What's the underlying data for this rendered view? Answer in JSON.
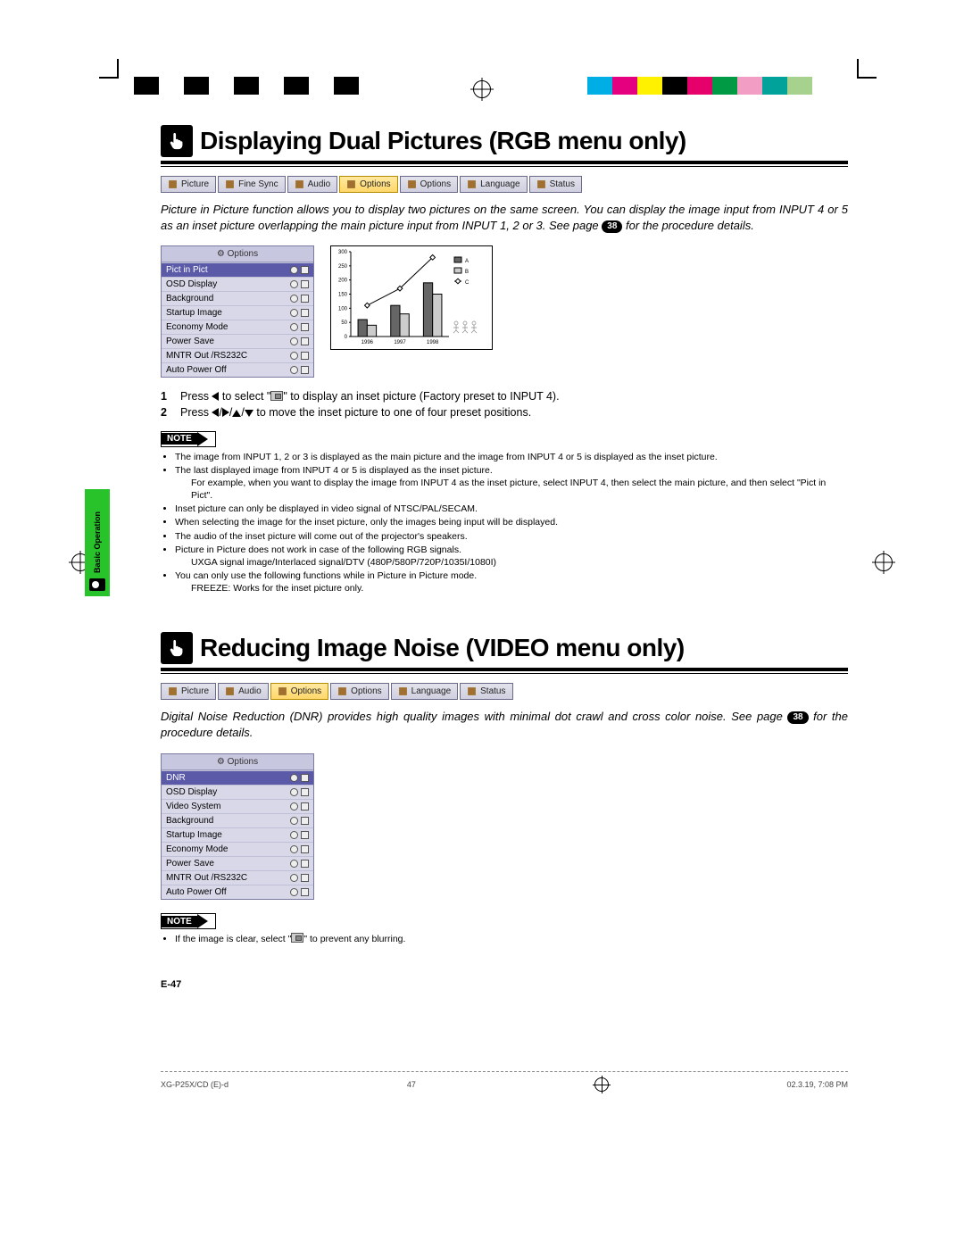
{
  "side_tab": "Basic Operation",
  "page_number": "E-47",
  "footer": {
    "left": "XG-P25X/CD (E)-d",
    "center": "47",
    "right": "02.3.19, 7:08 PM"
  },
  "color_bar_left": [
    "#000",
    "#fff",
    "#000",
    "#fff",
    "#000",
    "#fff",
    "#000",
    "#fff",
    "#000"
  ],
  "color_bar_right": [
    "#00aee6",
    "#e4007f",
    "#fff100",
    "#000",
    "#e5006b",
    "#009944",
    "#f29ec4",
    "#00a29a",
    "#a7d28d"
  ],
  "section1": {
    "title": "Displaying Dual Pictures (RGB menu only)",
    "tabs": [
      {
        "label": "Picture",
        "icon": "picture-icon"
      },
      {
        "label": "Fine Sync",
        "icon": "sync-icon"
      },
      {
        "label": "Audio",
        "icon": "audio-icon"
      },
      {
        "label": "Options",
        "icon": "options-icon",
        "active": true
      },
      {
        "label": "Options",
        "icon": "options-icon"
      },
      {
        "label": "Language",
        "icon": "language-icon"
      },
      {
        "label": "Status",
        "icon": "status-icon"
      }
    ],
    "intro_a": "Picture in Picture function allows you to display two pictures on the same screen. You can display the image input from INPUT 4 or 5 as an inset picture overlapping the main picture input from INPUT 1, 2 or 3. See page ",
    "intro_ref": "38",
    "intro_b": " for the procedure details.",
    "osd": {
      "header": "Options",
      "rows": [
        {
          "label": "Pict in Pict",
          "selected": true
        },
        {
          "label": "OSD Display"
        },
        {
          "label": "Background"
        },
        {
          "label": "Startup Image"
        },
        {
          "label": "Economy Mode"
        },
        {
          "label": "Power Save"
        },
        {
          "label": "MNTR Out /RS232C"
        },
        {
          "label": "Auto Power Off"
        }
      ]
    },
    "steps": [
      {
        "n": "1",
        "a": "Press ",
        "b": " to select \"",
        "c": "\" to display an inset picture (Factory preset to INPUT 4)."
      },
      {
        "n": "2",
        "a": "Press ",
        "b": " to move the inset picture to one of four preset positions."
      }
    ],
    "note_label": "NOTE",
    "notes": [
      "The image from INPUT 1, 2 or 3 is displayed as the main picture and the image from INPUT 4 or 5 is displayed as the inset picture.",
      "The last displayed image from INPUT 4 or 5 is displayed as the inset picture.",
      "__sub:For example, when you want to display the image from INPUT 4 as the inset picture, select INPUT 4, then select the main picture, and then select \"Pict in Pict\".",
      "Inset picture can only be displayed in video signal of NTSC/PAL/SECAM.",
      "When selecting the image for the inset picture, only the images being input will be displayed.",
      "The audio of the inset picture will come out of the projector's speakers.",
      "Picture in Picture does not work in case of the following RGB signals.",
      "__sub:UXGA signal image/Interlaced signal/DTV (480P/580P/720P/1035I/1080I)",
      "You can only use the following functions while in Picture in Picture mode.",
      "__sub:FREEZE: Works for the inset picture only."
    ]
  },
  "section2": {
    "title": "Reducing Image Noise (VIDEO menu only)",
    "tabs": [
      {
        "label": "Picture",
        "icon": "picture-icon"
      },
      {
        "label": "Audio",
        "icon": "audio-icon"
      },
      {
        "label": "Options",
        "icon": "options-icon",
        "active": true
      },
      {
        "label": "Options",
        "icon": "options-icon"
      },
      {
        "label": "Language",
        "icon": "language-icon"
      },
      {
        "label": "Status",
        "icon": "status-icon"
      }
    ],
    "intro_a": "Digital Noise Reduction (DNR) provides high quality images with minimal dot crawl and cross color noise. See page ",
    "intro_ref": "38",
    "intro_b": " for the procedure details.",
    "osd": {
      "header": "Options",
      "rows": [
        {
          "label": "DNR",
          "selected": true
        },
        {
          "label": "OSD Display"
        },
        {
          "label": "Video System"
        },
        {
          "label": "Background"
        },
        {
          "label": "Startup Image"
        },
        {
          "label": "Economy Mode"
        },
        {
          "label": "Power Save"
        },
        {
          "label": "MNTR Out /RS232C"
        },
        {
          "label": "Auto Power Off"
        }
      ]
    },
    "note_label": "NOTE",
    "notes": [
      "If the image is clear, select \"__icon\" to prevent any blurring."
    ]
  },
  "chart_data": {
    "type": "bar",
    "categories": [
      "1996",
      "1997",
      "1998"
    ],
    "series": [
      {
        "name": "A",
        "values": [
          60,
          110,
          190
        ]
      },
      {
        "name": "B",
        "values": [
          40,
          80,
          150
        ]
      }
    ],
    "line_series": {
      "name": "C",
      "values": [
        110,
        170,
        280
      ]
    },
    "ylim": [
      0,
      300
    ],
    "yticks": [
      0,
      50,
      100,
      150,
      200,
      250,
      300
    ],
    "title": "",
    "xlabel": "",
    "ylabel": ""
  }
}
